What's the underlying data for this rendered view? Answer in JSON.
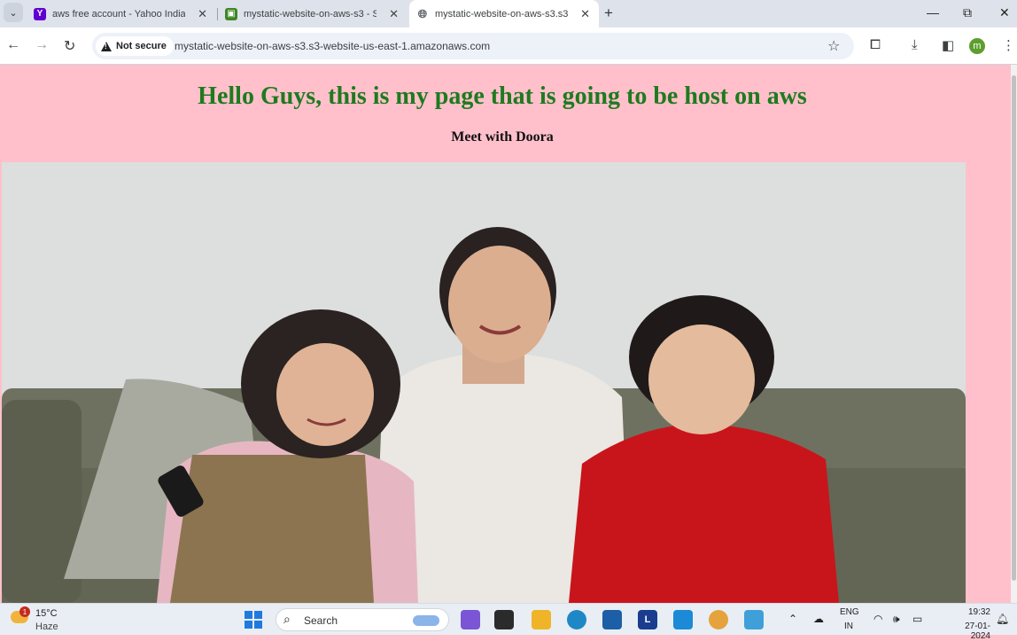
{
  "browser": {
    "tabs": [
      {
        "title": "aws free account - Yahoo India",
        "favicon": "yahoo-icon",
        "favicon_color": "#6001d2",
        "active": false
      },
      {
        "title": "mystatic-website-on-aws-s3 - S",
        "favicon": "s3-icon",
        "favicon_color": "#3f8624",
        "active": false
      },
      {
        "title": "mystatic-website-on-aws-s3.s3-",
        "favicon": "globe-icon",
        "favicon_color": "#5f6368",
        "active": true
      }
    ],
    "new_tab_symbol": "+",
    "security_label": "Not secure",
    "url": "mystatic-website-on-aws-s3.s3-website-us-east-1.amazonaws.com",
    "profile_initial": "m"
  },
  "page": {
    "heading": "Hello Guys, this is my page that is going to be host on aws",
    "subheading": "Meet with Doora",
    "image_subject": "mother and two children sitting on a sofa",
    "background_color": "#ffc0cb",
    "heading_color": "#1f7a1f"
  },
  "taskbar": {
    "weather_temp": "15°C",
    "weather_condition": "Haze",
    "weather_badge": "1",
    "search_label": "Search",
    "lang_line1": "ENG",
    "lang_line2": "IN",
    "time": "19:32",
    "date": "27-01-2024"
  }
}
